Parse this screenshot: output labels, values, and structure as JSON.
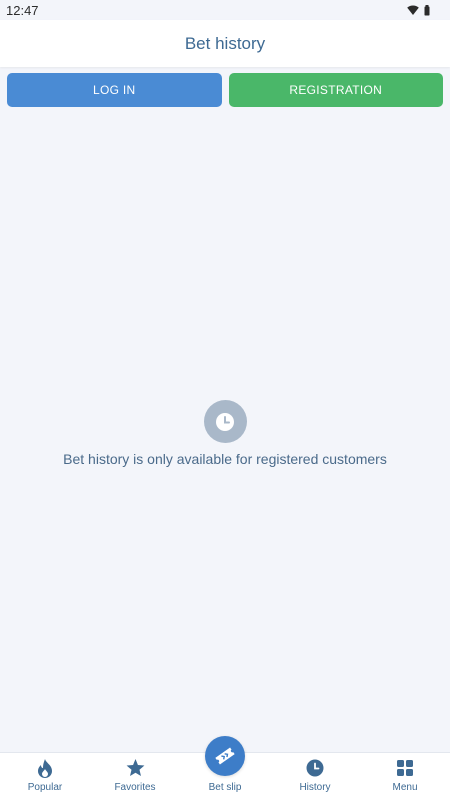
{
  "status_bar": {
    "time": "12:47"
  },
  "header": {
    "title": "Bet history"
  },
  "auth": {
    "login_label": "LOG IN",
    "register_label": "REGISTRATION"
  },
  "empty_state": {
    "message": "Bet history is only available for registered customers",
    "icon": "clock-icon"
  },
  "tabbar": {
    "items": [
      {
        "label": "Popular",
        "icon": "flame-icon"
      },
      {
        "label": "Favorites",
        "icon": "star-icon"
      },
      {
        "label": "Bet slip",
        "icon": "ticket-icon"
      },
      {
        "label": "History",
        "icon": "clock-icon"
      },
      {
        "label": "Menu",
        "icon": "grid-icon"
      }
    ]
  },
  "colors": {
    "primary": "#4a8bd4",
    "success": "#4ab769",
    "text": "#3e6a93",
    "background": "#f3f5fa"
  }
}
